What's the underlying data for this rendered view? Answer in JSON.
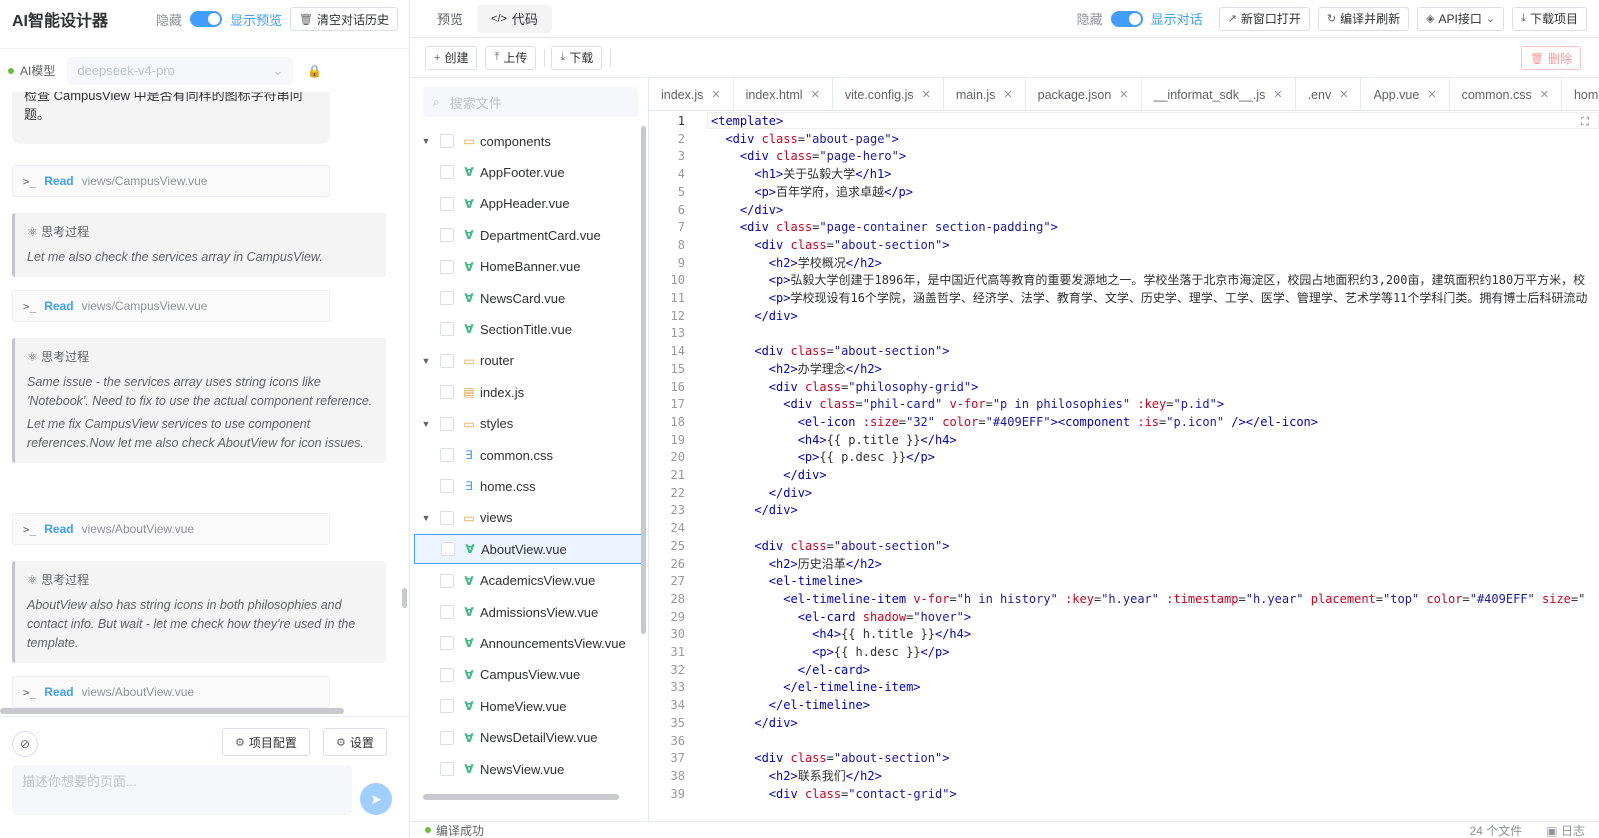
{
  "app": {
    "title": "AI智能设计器",
    "hide_label": "隐藏",
    "show_preview": "显示预览",
    "clear_history": "清空对话历史"
  },
  "model": {
    "label": "AI模型",
    "selected": "deepseek-v4-pro"
  },
  "chat": {
    "user_text": "检查 CampusView 中是否有同样的图标字符串问题。",
    "read_label": "Read",
    "think_title": "思考过程",
    "items": [
      {
        "type": "read",
        "path": "views/CampusView.vue"
      },
      {
        "type": "think",
        "paragraphs": [
          "Let me also check the services array in CampusView."
        ]
      },
      {
        "type": "read",
        "path": "views/CampusView.vue"
      },
      {
        "type": "think",
        "paragraphs": [
          "Same issue - the services array uses string icons like 'Notebook'. Need to fix to use the actual component reference.",
          "Let me fix CampusView services to use component references.Now let me also check AboutView for icon issues."
        ]
      },
      {
        "type": "read",
        "path": "views/AboutView.vue"
      },
      {
        "type": "think",
        "paragraphs": [
          "AboutView also has string icons in both philosophies and contact info. But wait - let me check how they're used in the template."
        ]
      },
      {
        "type": "read",
        "path": "views/AboutView.vue"
      }
    ],
    "project_config": "项目配置",
    "settings": "设置",
    "input_placeholder": "描述你想要的页面..."
  },
  "topbar": {
    "tab_preview": "预览",
    "tab_code": "代码",
    "hide_label": "隐藏",
    "show_chat": "显示对话",
    "open_new_window": "新窗口打开",
    "compile_refresh": "编译并刷新",
    "api": "API接口",
    "download_project": "下载项目"
  },
  "toolbar": {
    "create": "创建",
    "upload": "上传",
    "download": "下载",
    "delete": "删除"
  },
  "tree": {
    "search_placeholder": "搜索文件",
    "rows": [
      {
        "depth": 0,
        "kind": "folder",
        "name": "components",
        "expanded": true
      },
      {
        "depth": 1,
        "kind": "vue",
        "name": "AppFooter.vue"
      },
      {
        "depth": 1,
        "kind": "vue",
        "name": "AppHeader.vue"
      },
      {
        "depth": 1,
        "kind": "vue",
        "name": "DepartmentCard.vue"
      },
      {
        "depth": 1,
        "kind": "vue",
        "name": "HomeBanner.vue"
      },
      {
        "depth": 1,
        "kind": "vue",
        "name": "NewsCard.vue"
      },
      {
        "depth": 1,
        "kind": "vue",
        "name": "SectionTitle.vue"
      },
      {
        "depth": 0,
        "kind": "folder",
        "name": "router",
        "expanded": true
      },
      {
        "depth": 1,
        "kind": "js",
        "name": "index.js"
      },
      {
        "depth": 0,
        "kind": "folder",
        "name": "styles",
        "expanded": true
      },
      {
        "depth": 1,
        "kind": "css",
        "name": "common.css"
      },
      {
        "depth": 1,
        "kind": "css",
        "name": "home.css"
      },
      {
        "depth": 0,
        "kind": "folder",
        "name": "views",
        "expanded": true
      },
      {
        "depth": 1,
        "kind": "vue",
        "name": "AboutView.vue",
        "selected": true
      },
      {
        "depth": 1,
        "kind": "vue",
        "name": "AcademicsView.vue"
      },
      {
        "depth": 1,
        "kind": "vue",
        "name": "AdmissionsView.vue"
      },
      {
        "depth": 1,
        "kind": "vue",
        "name": "AnnouncementsView.vue"
      },
      {
        "depth": 1,
        "kind": "vue",
        "name": "CampusView.vue"
      },
      {
        "depth": 1,
        "kind": "vue",
        "name": "HomeView.vue"
      },
      {
        "depth": 1,
        "kind": "vue",
        "name": "NewsDetailView.vue"
      },
      {
        "depth": 1,
        "kind": "vue",
        "name": "NewsView.vue"
      }
    ]
  },
  "file_tabs": [
    "index.js",
    "index.html",
    "vite.config.js",
    "main.js",
    "package.json",
    "__informat_sdk__.js",
    ".env",
    "App.vue",
    "common.css",
    "home.css"
  ],
  "code": {
    "current_line": 1,
    "lines": [
      [
        [
          "t",
          "<template>"
        ]
      ],
      [
        [
          "p",
          "  "
        ],
        [
          "t",
          "<div"
        ],
        [
          "p",
          " "
        ],
        [
          "a",
          "class"
        ],
        [
          "p",
          "="
        ],
        [
          "s",
          "\"about-page\""
        ],
        [
          "t",
          ">"
        ]
      ],
      [
        [
          "p",
          "    "
        ],
        [
          "t",
          "<div"
        ],
        [
          "p",
          " "
        ],
        [
          "a",
          "class"
        ],
        [
          "p",
          "="
        ],
        [
          "s",
          "\"page-hero\""
        ],
        [
          "t",
          ">"
        ]
      ],
      [
        [
          "p",
          "      "
        ],
        [
          "t",
          "<h1>"
        ],
        [
          "p",
          "关于弘毅大学"
        ],
        [
          "t",
          "</h1>"
        ]
      ],
      [
        [
          "p",
          "      "
        ],
        [
          "t",
          "<p>"
        ],
        [
          "p",
          "百年学府，追求卓越"
        ],
        [
          "t",
          "</p>"
        ]
      ],
      [
        [
          "p",
          "    "
        ],
        [
          "t",
          "</div>"
        ]
      ],
      [
        [
          "p",
          "    "
        ],
        [
          "t",
          "<div"
        ],
        [
          "p",
          " "
        ],
        [
          "a",
          "class"
        ],
        [
          "p",
          "="
        ],
        [
          "s",
          "\"page-container section-padding\""
        ],
        [
          "t",
          ">"
        ]
      ],
      [
        [
          "p",
          "      "
        ],
        [
          "t",
          "<div"
        ],
        [
          "p",
          " "
        ],
        [
          "a",
          "class"
        ],
        [
          "p",
          "="
        ],
        [
          "s",
          "\"about-section\""
        ],
        [
          "t",
          ">"
        ]
      ],
      [
        [
          "p",
          "        "
        ],
        [
          "t",
          "<h2>"
        ],
        [
          "p",
          "学校概况"
        ],
        [
          "t",
          "</h2>"
        ]
      ],
      [
        [
          "p",
          "        "
        ],
        [
          "t",
          "<p>"
        ],
        [
          "p",
          "弘毅大学创建于1896年，是中国近代高等教育的重要发源地之一。学校坐落于北京市海淀区，校园占地面积约3,200亩，建筑面积约180万平方米，校"
        ]
      ],
      [
        [
          "p",
          "        "
        ],
        [
          "t",
          "<p>"
        ],
        [
          "p",
          "学校现设有16个学院，涵盖哲学、经济学、法学、教育学、文学、历史学、理学、工学、医学、管理学、艺术学等11个学科门类。拥有博士后科研流动"
        ]
      ],
      [
        [
          "p",
          "      "
        ],
        [
          "t",
          "</div>"
        ]
      ],
      [
        [
          "p",
          ""
        ]
      ],
      [
        [
          "p",
          "      "
        ],
        [
          "t",
          "<div"
        ],
        [
          "p",
          " "
        ],
        [
          "a",
          "class"
        ],
        [
          "p",
          "="
        ],
        [
          "s",
          "\"about-section\""
        ],
        [
          "t",
          ">"
        ]
      ],
      [
        [
          "p",
          "        "
        ],
        [
          "t",
          "<h2>"
        ],
        [
          "p",
          "办学理念"
        ],
        [
          "t",
          "</h2>"
        ]
      ],
      [
        [
          "p",
          "        "
        ],
        [
          "t",
          "<div"
        ],
        [
          "p",
          " "
        ],
        [
          "a",
          "class"
        ],
        [
          "p",
          "="
        ],
        [
          "s",
          "\"philosophy-grid\""
        ],
        [
          "t",
          ">"
        ]
      ],
      [
        [
          "p",
          "          "
        ],
        [
          "t",
          "<div"
        ],
        [
          "p",
          " "
        ],
        [
          "a",
          "class"
        ],
        [
          "p",
          "="
        ],
        [
          "s",
          "\"phil-card\""
        ],
        [
          "p",
          " "
        ],
        [
          "a",
          "v-for"
        ],
        [
          "p",
          "="
        ],
        [
          "s",
          "\"p in philosophies\""
        ],
        [
          "p",
          " "
        ],
        [
          "a",
          ":key"
        ],
        [
          "p",
          "="
        ],
        [
          "s",
          "\"p.id\""
        ],
        [
          "t",
          ">"
        ]
      ],
      [
        [
          "p",
          "            "
        ],
        [
          "t",
          "<el-icon"
        ],
        [
          "p",
          " "
        ],
        [
          "a",
          ":size"
        ],
        [
          "p",
          "="
        ],
        [
          "s",
          "\"32\""
        ],
        [
          "p",
          " "
        ],
        [
          "a",
          "color"
        ],
        [
          "p",
          "="
        ],
        [
          "s",
          "\"#409EFF\""
        ],
        [
          "t",
          ">"
        ],
        [
          "t",
          "<component"
        ],
        [
          "p",
          " "
        ],
        [
          "a",
          ":is"
        ],
        [
          "p",
          "="
        ],
        [
          "s",
          "\"p.icon\""
        ],
        [
          "p",
          " "
        ],
        [
          "t",
          "/>"
        ],
        [
          "t",
          "</el-icon>"
        ]
      ],
      [
        [
          "p",
          "            "
        ],
        [
          "t",
          "<h4>"
        ],
        [
          "p",
          "{{ p.title }}"
        ],
        [
          "t",
          "</h4>"
        ]
      ],
      [
        [
          "p",
          "            "
        ],
        [
          "t",
          "<p>"
        ],
        [
          "p",
          "{{ p.desc }}"
        ],
        [
          "t",
          "</p>"
        ]
      ],
      [
        [
          "p",
          "          "
        ],
        [
          "t",
          "</div>"
        ]
      ],
      [
        [
          "p",
          "        "
        ],
        [
          "t",
          "</div>"
        ]
      ],
      [
        [
          "p",
          "      "
        ],
        [
          "t",
          "</div>"
        ]
      ],
      [
        [
          "p",
          ""
        ]
      ],
      [
        [
          "p",
          "      "
        ],
        [
          "t",
          "<div"
        ],
        [
          "p",
          " "
        ],
        [
          "a",
          "class"
        ],
        [
          "p",
          "="
        ],
        [
          "s",
          "\"about-section\""
        ],
        [
          "t",
          ">"
        ]
      ],
      [
        [
          "p",
          "        "
        ],
        [
          "t",
          "<h2>"
        ],
        [
          "p",
          "历史沿革"
        ],
        [
          "t",
          "</h2>"
        ]
      ],
      [
        [
          "p",
          "        "
        ],
        [
          "t",
          "<el-timeline>"
        ]
      ],
      [
        [
          "p",
          "          "
        ],
        [
          "t",
          "<el-timeline-item"
        ],
        [
          "p",
          " "
        ],
        [
          "a",
          "v-for"
        ],
        [
          "p",
          "="
        ],
        [
          "s",
          "\"h in history\""
        ],
        [
          "p",
          " "
        ],
        [
          "a",
          ":key"
        ],
        [
          "p",
          "="
        ],
        [
          "s",
          "\"h.year\""
        ],
        [
          "p",
          " "
        ],
        [
          "a",
          ":timestamp"
        ],
        [
          "p",
          "="
        ],
        [
          "s",
          "\"h.year\""
        ],
        [
          "p",
          " "
        ],
        [
          "a",
          "placement"
        ],
        [
          "p",
          "="
        ],
        [
          "s",
          "\"top\""
        ],
        [
          "p",
          " "
        ],
        [
          "a",
          "color"
        ],
        [
          "p",
          "="
        ],
        [
          "s",
          "\"#409EFF\""
        ],
        [
          "p",
          " "
        ],
        [
          "a",
          "size"
        ],
        [
          "p",
          "=\""
        ]
      ],
      [
        [
          "p",
          "            "
        ],
        [
          "t",
          "<el-card"
        ],
        [
          "p",
          " "
        ],
        [
          "a",
          "shadow"
        ],
        [
          "p",
          "="
        ],
        [
          "s",
          "\"hover\""
        ],
        [
          "t",
          ">"
        ]
      ],
      [
        [
          "p",
          "              "
        ],
        [
          "t",
          "<h4>"
        ],
        [
          "p",
          "{{ h.title }}"
        ],
        [
          "t",
          "</h4>"
        ]
      ],
      [
        [
          "p",
          "              "
        ],
        [
          "t",
          "<p>"
        ],
        [
          "p",
          "{{ h.desc }}"
        ],
        [
          "t",
          "</p>"
        ]
      ],
      [
        [
          "p",
          "            "
        ],
        [
          "t",
          "</el-card>"
        ]
      ],
      [
        [
          "p",
          "          "
        ],
        [
          "t",
          "</el-timeline-item>"
        ]
      ],
      [
        [
          "p",
          "        "
        ],
        [
          "t",
          "</el-timeline>"
        ]
      ],
      [
        [
          "p",
          "      "
        ],
        [
          "t",
          "</div>"
        ]
      ],
      [
        [
          "p",
          ""
        ]
      ],
      [
        [
          "p",
          "      "
        ],
        [
          "t",
          "<div"
        ],
        [
          "p",
          " "
        ],
        [
          "a",
          "class"
        ],
        [
          "p",
          "="
        ],
        [
          "s",
          "\"about-section\""
        ],
        [
          "t",
          ">"
        ]
      ],
      [
        [
          "p",
          "        "
        ],
        [
          "t",
          "<h2>"
        ],
        [
          "p",
          "联系我们"
        ],
        [
          "t",
          "</h2>"
        ]
      ],
      [
        [
          "p",
          "        "
        ],
        [
          "t",
          "<div"
        ],
        [
          "p",
          " "
        ],
        [
          "a",
          "class"
        ],
        [
          "p",
          "="
        ],
        [
          "s",
          "\"contact-grid\""
        ],
        [
          "t",
          ">"
        ]
      ]
    ]
  },
  "status": {
    "compiled": "编译成功",
    "file_count": "24 个文件",
    "log": "日志"
  },
  "colors": {
    "primary": "#409eff",
    "success": "#67c23a",
    "tag": "#0000c0",
    "attr": "#d1001f",
    "string": "#1a1aa6"
  }
}
